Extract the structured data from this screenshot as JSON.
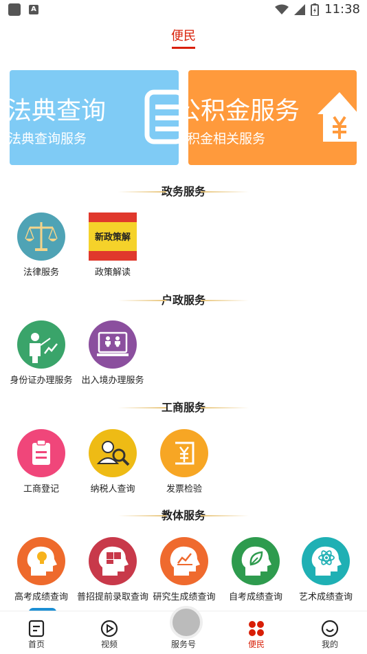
{
  "status_bar": {
    "time": "11:38"
  },
  "header": {
    "title": "便民"
  },
  "banners": [
    {
      "title": "法典查询",
      "subtitle": "法典查询服务",
      "color": "#7fcbf5"
    },
    {
      "title": "公积金服务",
      "subtitle": "积金相关服务",
      "color": "#ff9a3c"
    }
  ],
  "sections": [
    {
      "title": "政务服务",
      "items": [
        {
          "label": "法律服务",
          "icon": "scales-icon"
        },
        {
          "label": "政策解读",
          "icon": "policy-banner-icon",
          "banner_text": "新政策解"
        }
      ]
    },
    {
      "title": "户政服务",
      "items": [
        {
          "label": "身份证办理服务",
          "icon": "presenter-icon"
        },
        {
          "label": "出入境办理服务",
          "icon": "video-meeting-icon"
        }
      ]
    },
    {
      "title": "工商服务",
      "items": [
        {
          "label": "工商登记",
          "icon": "clipboard-icon"
        },
        {
          "label": "纳税人查询",
          "icon": "person-search-icon"
        },
        {
          "label": "发票检验",
          "icon": "yen-receipt-icon"
        }
      ]
    },
    {
      "title": "教体服务",
      "items": [
        {
          "label": "高考成绩查询",
          "icon": "head-bulb-icon"
        },
        {
          "label": "普招提前录取查询",
          "icon": "head-puzzle-icon"
        },
        {
          "label": "研究生成绩查询",
          "icon": "head-chart-icon"
        },
        {
          "label": "自考成绩查询",
          "icon": "head-leaf-icon"
        },
        {
          "label": "艺术成绩查询",
          "icon": "head-atom-icon"
        }
      ]
    }
  ],
  "tabs": [
    {
      "label": "首页",
      "icon": "home-doc-icon"
    },
    {
      "label": "视频",
      "icon": "play-icon"
    },
    {
      "label": "服务号",
      "icon": "service-icon"
    },
    {
      "label": "便民",
      "icon": "grid-dots-icon",
      "active": true
    },
    {
      "label": "我的",
      "icon": "smile-icon"
    }
  ],
  "colors": {
    "accent": "#d81e06"
  }
}
